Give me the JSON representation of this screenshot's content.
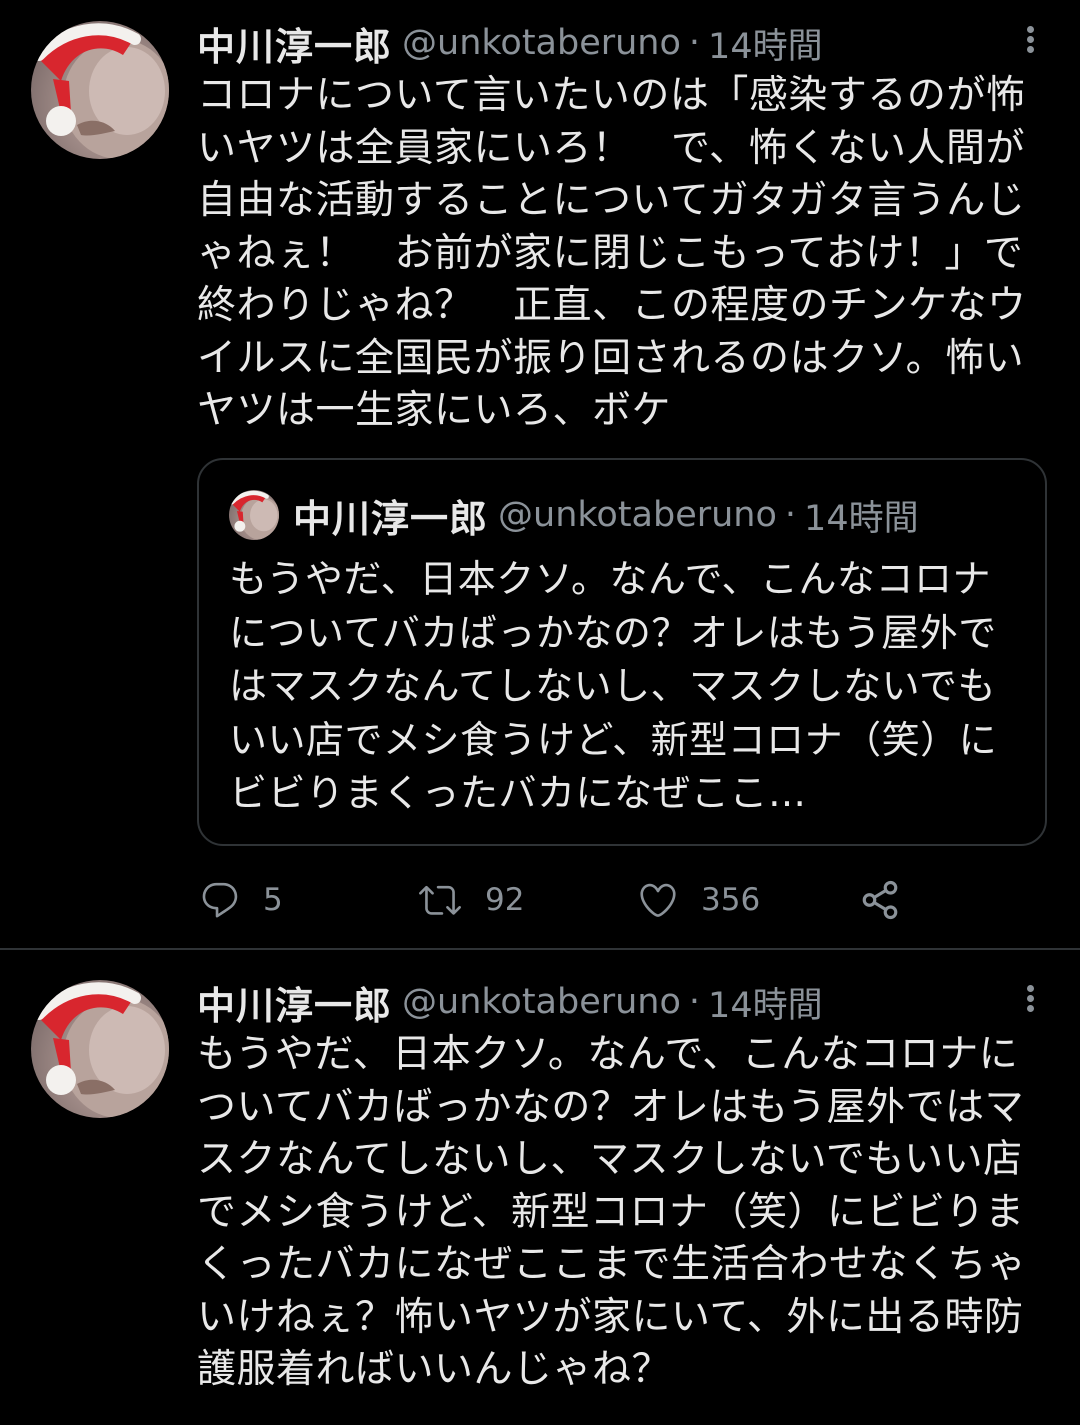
{
  "tweets": [
    {
      "author": {
        "name": "中川淳一郎",
        "handle": "@unkotaberuno"
      },
      "separator": "·",
      "time": "14時間",
      "text": "コロナについて言いたいのは「感染するのが怖いヤツは全員家にいろ！　で、怖くない人間が自由な活動することについてガタガタ言うんじゃねぇ！　お前が家に閉じこもっておけ！」で終わりじゃね？　正直、この程度のチンケなウイルスに全国民が振り回されるのはクソ。怖いヤツは一生家にいろ、ボケ",
      "quote": {
        "author": {
          "name": "中川淳一郎",
          "handle": "@unkotaberuno"
        },
        "separator": "·",
        "time": "14時間",
        "text": "もうやだ、日本クソ。なんで、こんなコロナについてバカばっかなの？オレはもう屋外ではマスクなんてしないし、マスクしないでもいい店でメシ食うけど、新型コロナ（笑）にビビりまくったバカになぜここ…"
      },
      "stats": {
        "replies": "5",
        "retweets": "92",
        "likes": "356"
      }
    },
    {
      "author": {
        "name": "中川淳一郎",
        "handle": "@unkotaberuno"
      },
      "separator": "·",
      "time": "14時間",
      "text": "もうやだ、日本クソ。なんで、こんなコロナについてバカばっかなの？オレはもう屋外ではマスクなんてしないし、マスクしないでもいい店でメシ食うけど、新型コロナ（笑）にビビりまくったバカになぜここまで生活合わせなくちゃいけねぇ？怖いヤツが家にいて、外に出る時防護服着ればいいんじゃね？"
    }
  ],
  "icons": {
    "more": "more-vertical-icon",
    "reply": "reply-icon",
    "retweet": "retweet-icon",
    "like": "heart-icon",
    "share": "share-icon"
  },
  "colors": {
    "background": "#000000",
    "text": "#e8e8e8",
    "secondary": "#8b9299",
    "border": "#2f3336",
    "avatar_hat_red": "#d8262e",
    "avatar_hat_white": "#f3f1ee"
  }
}
